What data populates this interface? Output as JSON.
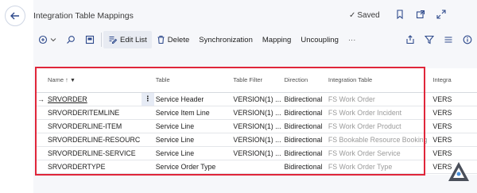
{
  "header": {
    "title": "Integration Table Mappings",
    "saved_label": "Saved"
  },
  "toolbar": {
    "edit_list": "Edit List",
    "delete": "Delete",
    "synchronization": "Synchronization",
    "mapping": "Mapping",
    "uncoupling": "Uncoupling",
    "more": "···"
  },
  "table": {
    "columns": [
      "Name ↑",
      "Table",
      "Table Filter",
      "Direction",
      "Integration Table",
      "Integra"
    ],
    "rows": [
      {
        "name": "SRVORDER",
        "table": "Service Header",
        "filter": "VERSION(1) ...",
        "direction": "Bidirectional",
        "integration": "FS Work Order",
        "extra": "VERS"
      },
      {
        "name": "SRVORDERITEMLINE",
        "table": "Service Item Line",
        "filter": "VERSION(1) ...",
        "direction": "Bidirectional",
        "integration": "FS Work Order Incident",
        "extra": "VERS"
      },
      {
        "name": "SRVORDERLINE-ITEM",
        "table": "Service Line",
        "filter": "VERSION(1) ...",
        "direction": "Bidirectional",
        "integration": "FS Work Order Product",
        "extra": "VERS"
      },
      {
        "name": "SRVORDERLINE-RESOURC",
        "table": "Service Line",
        "filter": "VERSION(1) ...",
        "direction": "Bidirectional",
        "integration": "FS Bookable Resource Booking",
        "extra": "VERS"
      },
      {
        "name": "SRVORDERLINE-SERVICE",
        "table": "Service Line",
        "filter": "VERSION(1) ...",
        "direction": "Bidirectional",
        "integration": "FS Work Order Service",
        "extra": "VERS"
      },
      {
        "name": "SRVORDERTYPE",
        "table": "Service Order Type",
        "filter": "",
        "direction": "Bidirectional",
        "integration": "FS Work Order Type",
        "extra": "VERS"
      }
    ]
  },
  "icons": {
    "back": "back-arrow-icon",
    "bookmark": "bookmark-icon",
    "open_new": "open-in-new-window-icon",
    "expand": "expand-icon",
    "share": "share-icon",
    "filter": "filter-icon",
    "list": "list-view-icon",
    "info": "info-icon"
  },
  "colors": {
    "highlight_border": "#e0263a",
    "accent": "#2e4a8c"
  }
}
